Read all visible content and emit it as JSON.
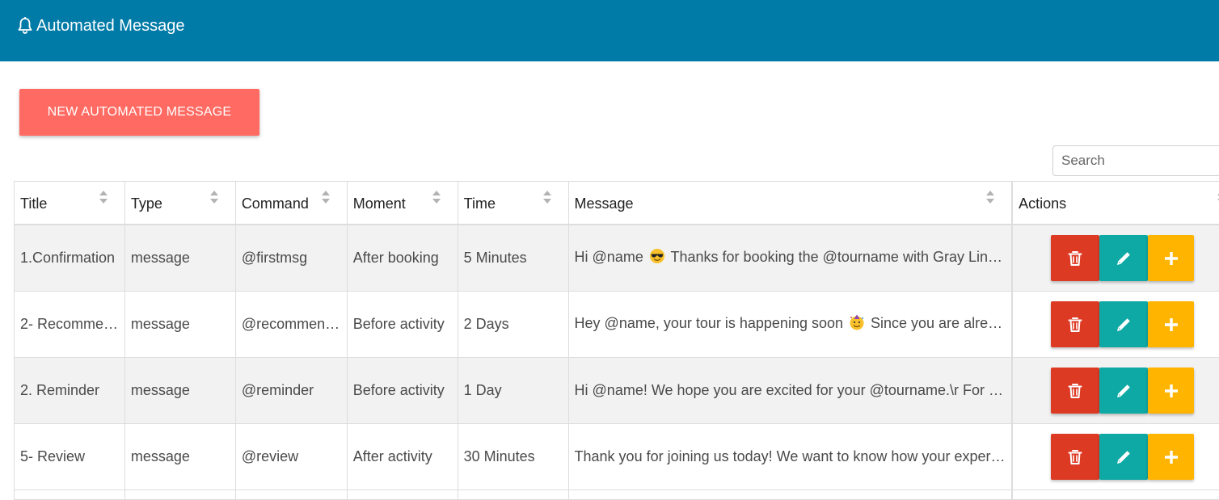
{
  "header": {
    "title": "Automated Message",
    "icon": "bell-icon"
  },
  "new_button_label": "NEW AUTOMATED MESSAGE",
  "search": {
    "placeholder": "Search",
    "value": ""
  },
  "columns": [
    "Title",
    "Type",
    "Command",
    "Moment",
    "Time",
    "Message",
    "Actions"
  ],
  "rows": [
    {
      "title": "1.Confirmation",
      "type": "message",
      "command": "@firstmsg",
      "moment": "After booking",
      "time": "5 Minutes",
      "message_pre": "Hi @name ",
      "message_emoji": "smiling-face-with-sunglasses",
      "message_post": " Thanks for booking the @tourname with Gray Line E…"
    },
    {
      "title": "2- Recommen…",
      "type": "message",
      "command": "@recommend…",
      "moment": "Before activity",
      "time": "2 Days",
      "message_pre": "Hey @name, your tour is happening soon ",
      "message_emoji": "partying-face",
      "message_post": " Since you are already…"
    },
    {
      "title": "2. Reminder",
      "type": "message",
      "command": "@reminder",
      "moment": "Before activity",
      "time": "1 Day",
      "message_pre": "Hi @name! We hope you are excited for your @tourname.\\r For yo…",
      "message_emoji": "",
      "message_post": ""
    },
    {
      "title": "5- Review",
      "type": "message",
      "command": "@review",
      "moment": "After activity",
      "time": "30 Minutes",
      "message_pre": "Thank you for joining us today! We want to know how your experie…",
      "message_emoji": "",
      "message_post": ""
    }
  ],
  "colors": {
    "header_bg": "#007aa7",
    "new_button": "#ff6a62",
    "delete": "#dd3a24",
    "edit": "#0fa9a5",
    "add": "#ffb400",
    "row_alt": "#f2f2f2"
  }
}
